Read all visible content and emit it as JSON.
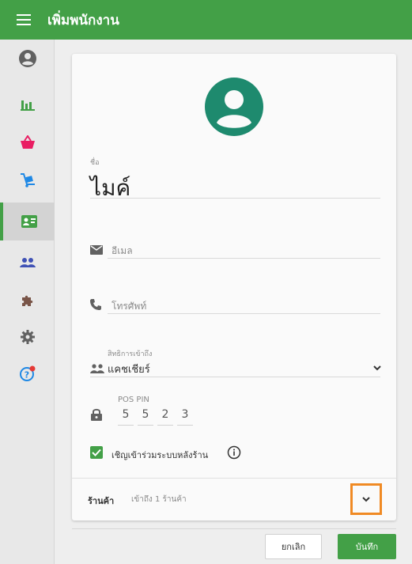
{
  "header": {
    "title": "เพิ่มพนักงาน",
    "menu_icon": "hamburger-icon"
  },
  "sidebar": {
    "items": [
      {
        "icon": "account-circle-icon",
        "color": "#616161"
      },
      {
        "icon": "bar-chart-icon",
        "color": "#43a047"
      },
      {
        "icon": "shopping-basket-icon",
        "color": "#e91e63"
      },
      {
        "icon": "delivery-cart-icon",
        "color": "#1e88e5"
      },
      {
        "icon": "employee-card-icon",
        "color": "#43a047",
        "active": true
      },
      {
        "icon": "people-icon",
        "color": "#3f51b5"
      },
      {
        "icon": "puzzle-icon",
        "color": "#795548"
      },
      {
        "icon": "settings-icon",
        "color": "#616161"
      },
      {
        "icon": "help-icon",
        "color": "#1e88e5",
        "badge_color": "#e53935"
      }
    ]
  },
  "form": {
    "name_label": "ชื่อ",
    "name_value": "ไมค์",
    "email_placeholder": "อีเมล",
    "phone_placeholder": "โทรศัพท์",
    "access_label": "สิทธิการเข้าถึง",
    "access_value": "แคชเชียร์",
    "pin_label": "POS PIN",
    "pin_digits": [
      "5",
      "5",
      "2",
      "3"
    ],
    "invite_label": "เชิญเข้าร่วมระบบหลังร้าน",
    "invite_checked": true,
    "shop_label": "ร้านค้า",
    "shop_value": "เข้าถึง 1 ร้านค้า"
  },
  "actions": {
    "cancel_label": "ยกเลิก",
    "save_label": "บันทึก"
  },
  "colors": {
    "accent": "#43a047",
    "highlight": "#f08a24"
  }
}
